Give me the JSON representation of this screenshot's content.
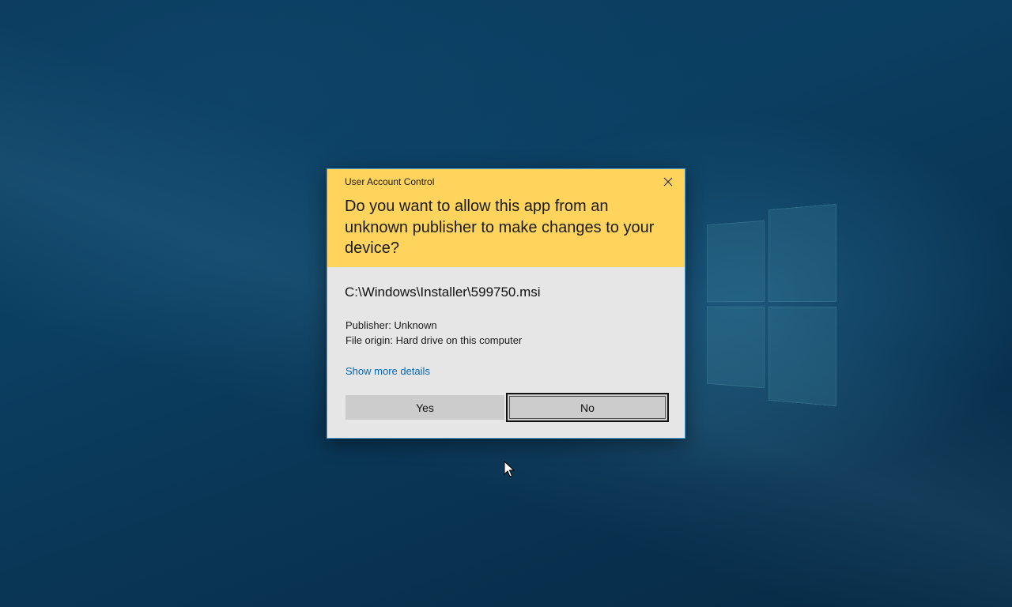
{
  "dialog": {
    "title": "User Account Control",
    "question": "Do you want to allow this app from an unknown publisher to make changes to your device?",
    "file_path": "C:\\Windows\\Installer\\599750.msi",
    "publisher": "Publisher: Unknown",
    "file_origin": "File origin: Hard drive on this computer",
    "details_link": "Show more details",
    "yes_label": "Yes",
    "no_label": "No",
    "close_icon": "close-icon"
  },
  "colors": {
    "header_bg": "#ffd45c",
    "body_bg": "#e6e6e6",
    "link": "#0a67b8",
    "border": "#4a9ad4",
    "desktop": "#0b3f62"
  }
}
